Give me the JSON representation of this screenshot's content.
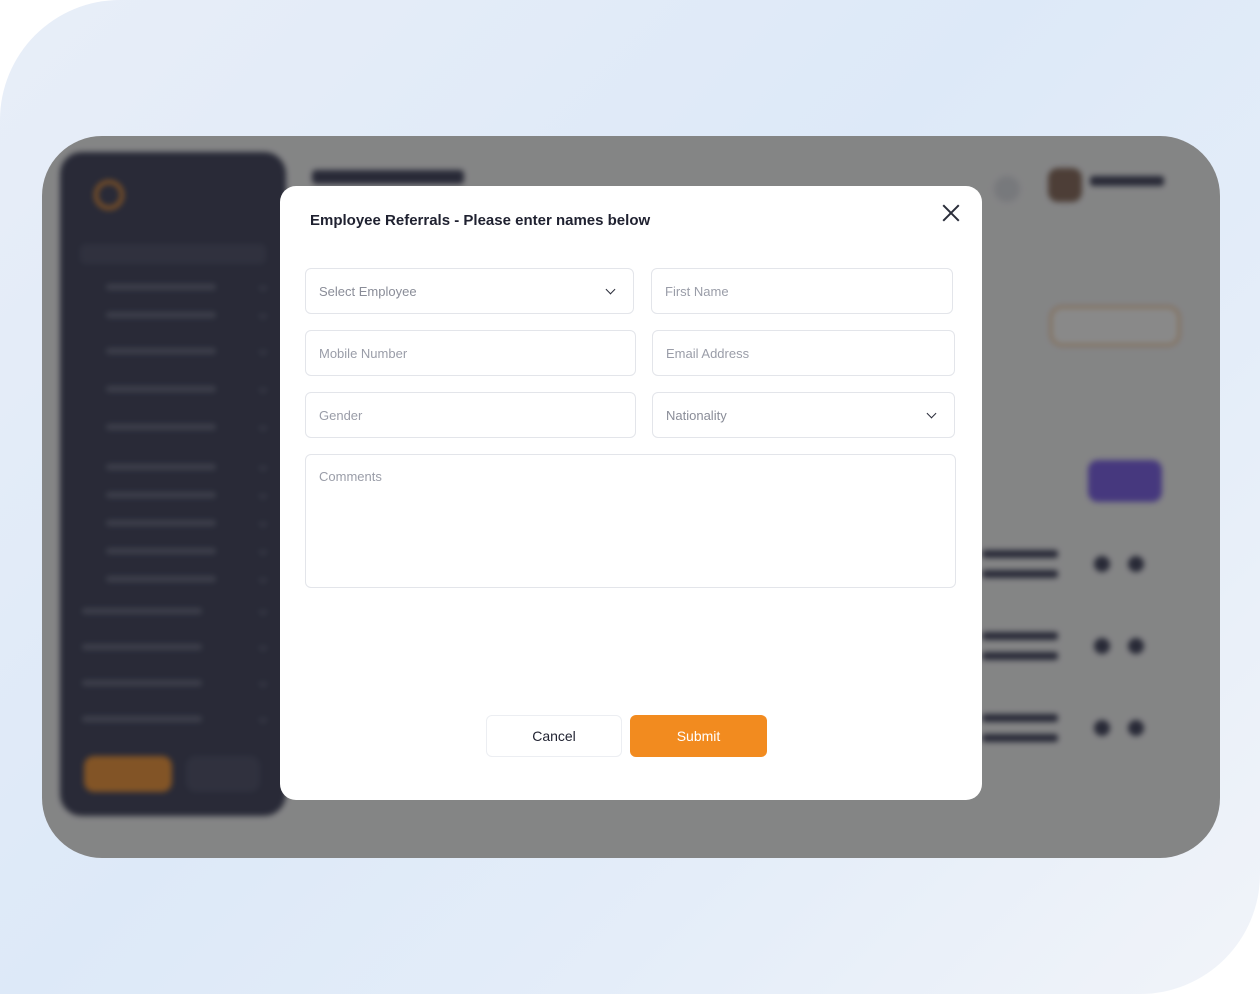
{
  "modal": {
    "title": "Employee Referrals - Please enter names below",
    "fields": {
      "select_employee": {
        "placeholder": "Select Employee"
      },
      "first_name": {
        "placeholder": "First Name"
      },
      "mobile_number": {
        "placeholder": "Mobile Number"
      },
      "email_address": {
        "placeholder": "Email Address"
      },
      "gender": {
        "placeholder": "Gender"
      },
      "nationality": {
        "placeholder": "Nationality"
      },
      "comments": {
        "placeholder": "Comments"
      }
    },
    "buttons": {
      "cancel_label": "Cancel",
      "submit_label": "Submit"
    }
  },
  "icons": {
    "close": "close-icon",
    "dropdown": "chevron-down-icon"
  },
  "colors": {
    "accent": "#f28b1f",
    "sidebar": "#2a2d4a",
    "overlay": "rgba(40,40,40,0.55)",
    "secondary_accent": "#6b4de6"
  }
}
